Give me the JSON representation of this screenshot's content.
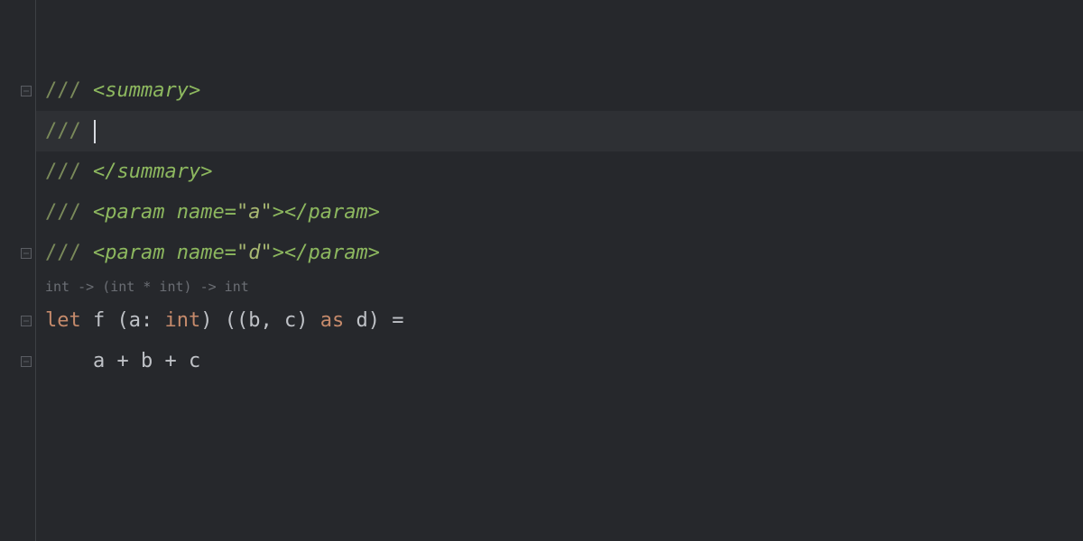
{
  "doc": {
    "slashes": "///",
    "summary_open": "<summary>",
    "summary_close": "</summary>",
    "param_open": "<param",
    "param_name_attr": "name",
    "param_a_val": "\"a\"",
    "param_d_val": "\"d\"",
    "param_close_tag": "></param>"
  },
  "hint": {
    "type_sig": "int -> (int * int) -> int"
  },
  "code": {
    "let_kw": "let",
    "fn_name": "f",
    "lparen": "(",
    "rparen": ")",
    "a_ident": "a",
    "colon": ":",
    "int_type": "int",
    "b_ident": "b",
    "c_ident": "c",
    "comma": ",",
    "as_kw": "as",
    "d_ident": "d",
    "eq": "=",
    "plus": "+",
    "body_indent": "    "
  }
}
